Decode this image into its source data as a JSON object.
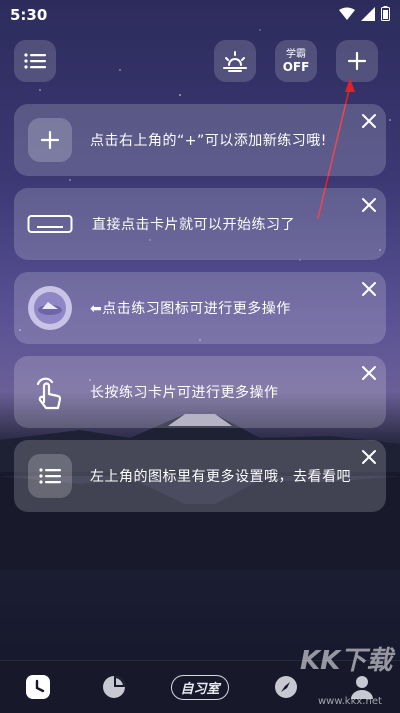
{
  "status_bar": {
    "time": "5:30"
  },
  "header": {
    "menu_icon": "list-icon",
    "sun_icon": "sunrise-icon",
    "xueba_label": "学霸",
    "xueba_state": "OFF",
    "add_icon": "plus-icon"
  },
  "cards": [
    {
      "icon": "plus-icon",
      "text": "点击右上角的“+”可以添加新练习哦!"
    },
    {
      "icon": "card-outline-icon",
      "text": "直接点击卡片就可以开始练习了"
    },
    {
      "icon": "planet-icon",
      "text": "⬅点击练习图标可进行更多操作"
    },
    {
      "icon": "tap-hand-icon",
      "text": "长按练习卡片可进行更多操作"
    },
    {
      "icon": "list-icon",
      "text": "左上角的图标里有更多设置哦，去看看吧"
    }
  ],
  "bottom_nav": {
    "study_room_label": "自习室",
    "items": [
      "clock-icon",
      "pie-chart-icon",
      "study-room",
      "compass-icon",
      "profile-icon"
    ]
  },
  "watermark": {
    "text": "KK下载",
    "url": "www.kkx.net"
  },
  "colors": {
    "accent_arrow": "#e0202a",
    "nav_bg": "#17182a"
  }
}
